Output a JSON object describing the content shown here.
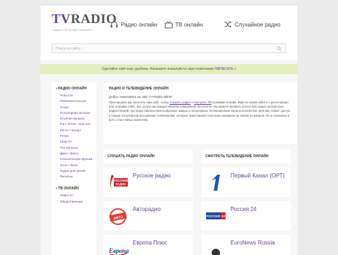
{
  "header": {
    "logo_tv": "TV",
    "logo_radio": "RADIO",
    "tagline": "радио и ТВ онлайн бесплатно",
    "nav": [
      {
        "label": "Радио онлайн",
        "icon": "headphones-icon"
      },
      {
        "label": "ТВ онлайн",
        "icon": "tv-icon"
      },
      {
        "label": "Случайное радио",
        "icon": "shuffle-icon"
      }
    ],
    "search_placeholder": "Поиск по сайту..."
  },
  "banner": {
    "text": "Сделайте сайт еще удобнее. Напишите пожалуйста свое пожелание",
    "link": "НАПИСАТЬ »"
  },
  "sidebar": {
    "radio_heading": "• РАДИО ОНЛАЙН",
    "radio_items": [
      "Новости",
      "Развлекательные",
      "Спорт",
      "Популярная музыка",
      "Клубная музыка",
      "Рэп / R'n'B / Хип-Хоп",
      "Регги / Чилаут",
      "Ретро",
      "Шансон",
      "Рок-Музыка",
      "Джаз / Блюз",
      "Классическая музыка",
      "Этно / Фолк",
      "Радио для детей",
      "Регионы"
    ],
    "tv_heading": "• ТВ ОНЛАЙН",
    "tv_items": [
      "Новости",
      "Общественные"
    ]
  },
  "intro": {
    "title": "РАДИО И ТЕЛЕВИДЕНИЕ ОНЛАЙН",
    "greeting": "Добро пожаловать на сайт TV-Radio.online!",
    "body_start": "Приглашаем вас посетить наш сайт, чтобы",
    "link_radio": "слушать радио",
    "body_and": "и",
    "link_tv": "смотреть ТВ",
    "body_rest": "в режиме онлайн. Вам не нужна забота о регистрации или отправке СМС, все услуги мы предоставляем совершенно бесплатно. Вы можете выбрать более 400 самых интересных радиостанций, где представлены разнообразные жанры и популярные телевизионные каналы в качестве. Для вас открыт доступ к самым популярным российским телеканалам, которые транслируют полезную передачи на любой из жанров, это и полезные и всё о счастливых моментах."
  },
  "radio_column": {
    "heading": "СЛУШАТЬ РАДИО ОНЛАЙН",
    "stations": [
      {
        "name": "Русское радио",
        "logo_text": "РУССКОЕ РАДИО",
        "color": "#d6202a"
      },
      {
        "name": "Авторадио",
        "logo_text": "АВТО РАДИО",
        "color": "#e53935"
      },
      {
        "name": "Европа Плюс",
        "logo_text": "Европа",
        "color": "#1a3c8c"
      }
    ]
  },
  "tv_column": {
    "heading": "СМОТРЕТЬ ТЕЛЕВИДЕНИЕ ОНЛАЙН",
    "channels": [
      {
        "name": "Первый Канал (ОРТ)",
        "logo_text": "1",
        "color": "#1a5bb5"
      },
      {
        "name": "Россия 24",
        "logo_text": "РОССИЯ 24",
        "color": "#1c4aa0"
      },
      {
        "name": "EuroNews Russia",
        "logo_text": "",
        "color": "#333333"
      }
    ]
  }
}
